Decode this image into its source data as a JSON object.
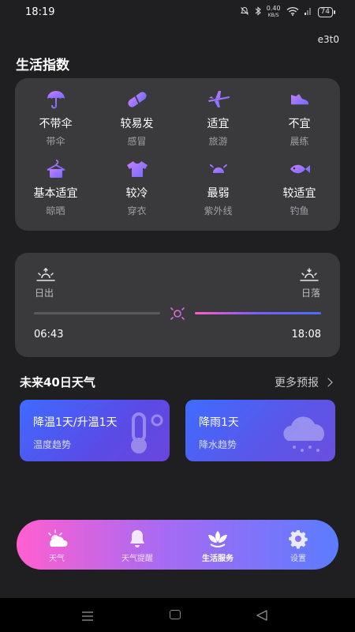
{
  "status_bar": {
    "time": "18:19",
    "net_speed_value": "0.40",
    "net_speed_unit": "KB/S",
    "battery": "74"
  },
  "user_code": "e3t0",
  "life_index": {
    "title": "生活指数",
    "items": [
      {
        "value": "不带伞",
        "label": "带伞",
        "icon": "umbrella-icon"
      },
      {
        "value": "较易发",
        "label": "感冒",
        "icon": "pill-icon"
      },
      {
        "value": "适宜",
        "label": "旅游",
        "icon": "airplane-icon"
      },
      {
        "value": "不宜",
        "label": "晨练",
        "icon": "sneaker-icon"
      },
      {
        "value": "基本适宜",
        "label": "晾晒",
        "icon": "hanger-icon"
      },
      {
        "value": "较冷",
        "label": "穿衣",
        "icon": "tshirt-icon"
      },
      {
        "value": "最弱",
        "label": "紫外线",
        "icon": "sun-icon"
      },
      {
        "value": "较适宜",
        "label": "钓鱼",
        "icon": "fish-icon"
      }
    ]
  },
  "sun": {
    "sunrise_label": "日出",
    "sunset_label": "日落",
    "sunrise_time": "06:43",
    "sunset_time": "18:08",
    "progress": 0.5
  },
  "forecast": {
    "title": "未来40日天气",
    "more_label": "更多预报",
    "cards": [
      {
        "title": "降温1天/升温1天",
        "subtitle": "温度趋势",
        "icon": "thermometer-icon"
      },
      {
        "title": "降雨1天",
        "subtitle": "降水趋势",
        "icon": "rain-cloud-icon"
      }
    ]
  },
  "tabbar": {
    "active": "生活服务",
    "tabs": [
      {
        "label": "天气",
        "icon": "weather-icon"
      },
      {
        "label": "天气提醒",
        "icon": "bell-icon"
      },
      {
        "label": "生活服务",
        "icon": "lotus-icon"
      },
      {
        "label": "设置",
        "icon": "gear-icon"
      }
    ]
  },
  "colors": {
    "icon_gradient_start": "#a86bff",
    "icon_gradient_end": "#ff6fcf",
    "tabbar_start": "#ff5fd0",
    "tabbar_end": "#5b7cff"
  }
}
